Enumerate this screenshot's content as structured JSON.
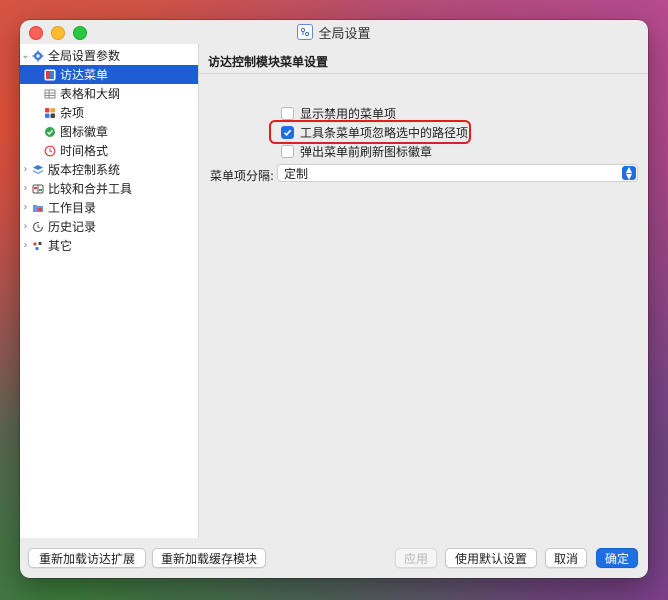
{
  "window": {
    "title": "全局设置"
  },
  "sidebar": {
    "items": [
      {
        "label": "全局设置参数"
      },
      {
        "label": "访达菜单"
      },
      {
        "label": "表格和大纲"
      },
      {
        "label": "杂项"
      },
      {
        "label": "图标徽章"
      },
      {
        "label": "时间格式"
      },
      {
        "label": "版本控制系统"
      },
      {
        "label": "比较和合并工具"
      },
      {
        "label": "工作目录"
      },
      {
        "label": "历史记录"
      },
      {
        "label": "其它"
      }
    ]
  },
  "panel": {
    "title": "访达控制模块菜单设置",
    "options": [
      {
        "label": "显示禁用的菜单项",
        "checked": false
      },
      {
        "label": "工具条菜单项忽略选中的路径项",
        "checked": true
      },
      {
        "label": "弹出菜单前刷新图标徽章",
        "checked": false
      }
    ],
    "separator": {
      "label": "菜单项分隔:",
      "value": "定制"
    }
  },
  "footer": {
    "reload_extension": "重新加载访达扩展",
    "reload_cache": "重新加载缓存模块",
    "apply": "应用",
    "use_defaults": "使用默认设置",
    "cancel": "取消",
    "ok": "确定"
  }
}
